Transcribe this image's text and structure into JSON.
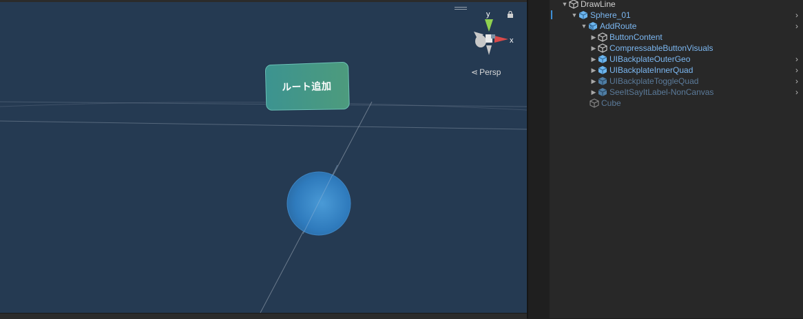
{
  "scene": {
    "button_text": "ルート追加",
    "persp_label": "Persp",
    "gizmo_axis_y": "y",
    "gizmo_axis_x": "x",
    "colors": {
      "background": "#253a52",
      "button": "#45967f",
      "sphere": "#2f7bbd",
      "gizmo_y": "#8fd14f",
      "gizmo_x": "#d94a4a"
    }
  },
  "hierarchy": {
    "rows": [
      {
        "label": "DrawLine",
        "expanded": true,
        "icon": "cube-outline-icon"
      },
      {
        "label": "Sphere_01",
        "expanded": true,
        "icon": "prefab-cube-icon"
      },
      {
        "label": "AddRoute",
        "expanded": true,
        "icon": "prefab-variant-icon"
      },
      {
        "label": "ButtonContent",
        "expanded": false,
        "icon": "cube-outline-icon"
      },
      {
        "label": "CompressableButtonVisuals",
        "expanded": false,
        "icon": "cube-outline-icon"
      },
      {
        "label": "UIBackplateOuterGeo",
        "expanded": false,
        "icon": "prefab-cube-icon"
      },
      {
        "label": "UIBackplateInnerQuad",
        "expanded": false,
        "icon": "prefab-cube-icon"
      },
      {
        "label": "UIBackplateToggleQuad",
        "expanded": false,
        "icon": "prefab-cube-icon"
      },
      {
        "label": "SeeItSayItLabel-NonCanvas",
        "expanded": false,
        "icon": "prefab-cube-icon"
      },
      {
        "label": "Cube",
        "icon": "cube-outline-icon"
      }
    ],
    "chevron": "›"
  }
}
